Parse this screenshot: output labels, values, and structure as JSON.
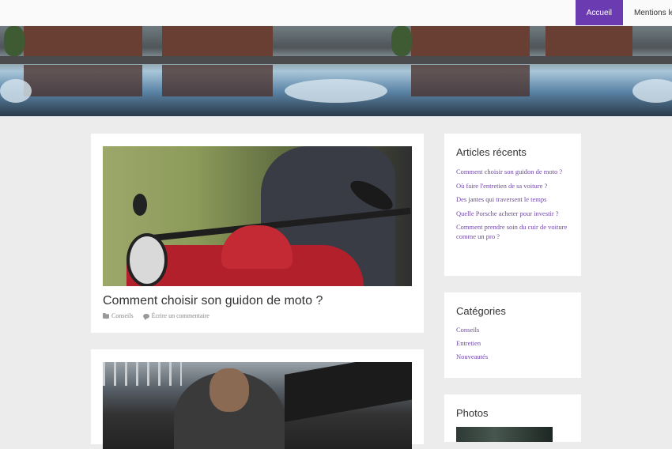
{
  "nav": {
    "items": [
      {
        "label": "Accueil",
        "active": true
      },
      {
        "label": "Mentions légales",
        "active": false
      }
    ]
  },
  "posts": [
    {
      "title": "Comment choisir son guidon de moto ?",
      "category": "Conseils",
      "comment_label": "Écrire un commentaire",
      "image": "motorcycle-rider-photo"
    },
    {
      "image": "mechanic-working-under-hood-photo"
    }
  ],
  "sidebar": {
    "recent": {
      "title": "Articles récents",
      "items": [
        "Comment choisir son guidon de moto ?",
        "Où faire l'entretien de sa voiture ?",
        "Des jantes qui traversent le temps",
        "Quelle Porsche acheter pour investir ?",
        "Comment prendre soin du cuir de voiture comme un pro ?"
      ]
    },
    "categories": {
      "title": "Catégories",
      "items": [
        "Conseils",
        "Entretien",
        "Nouveautés"
      ]
    },
    "photos": {
      "title": "Photos"
    }
  },
  "colors": {
    "accent": "#6a3bb1",
    "link": "#7048a8",
    "background": "#ececec"
  }
}
